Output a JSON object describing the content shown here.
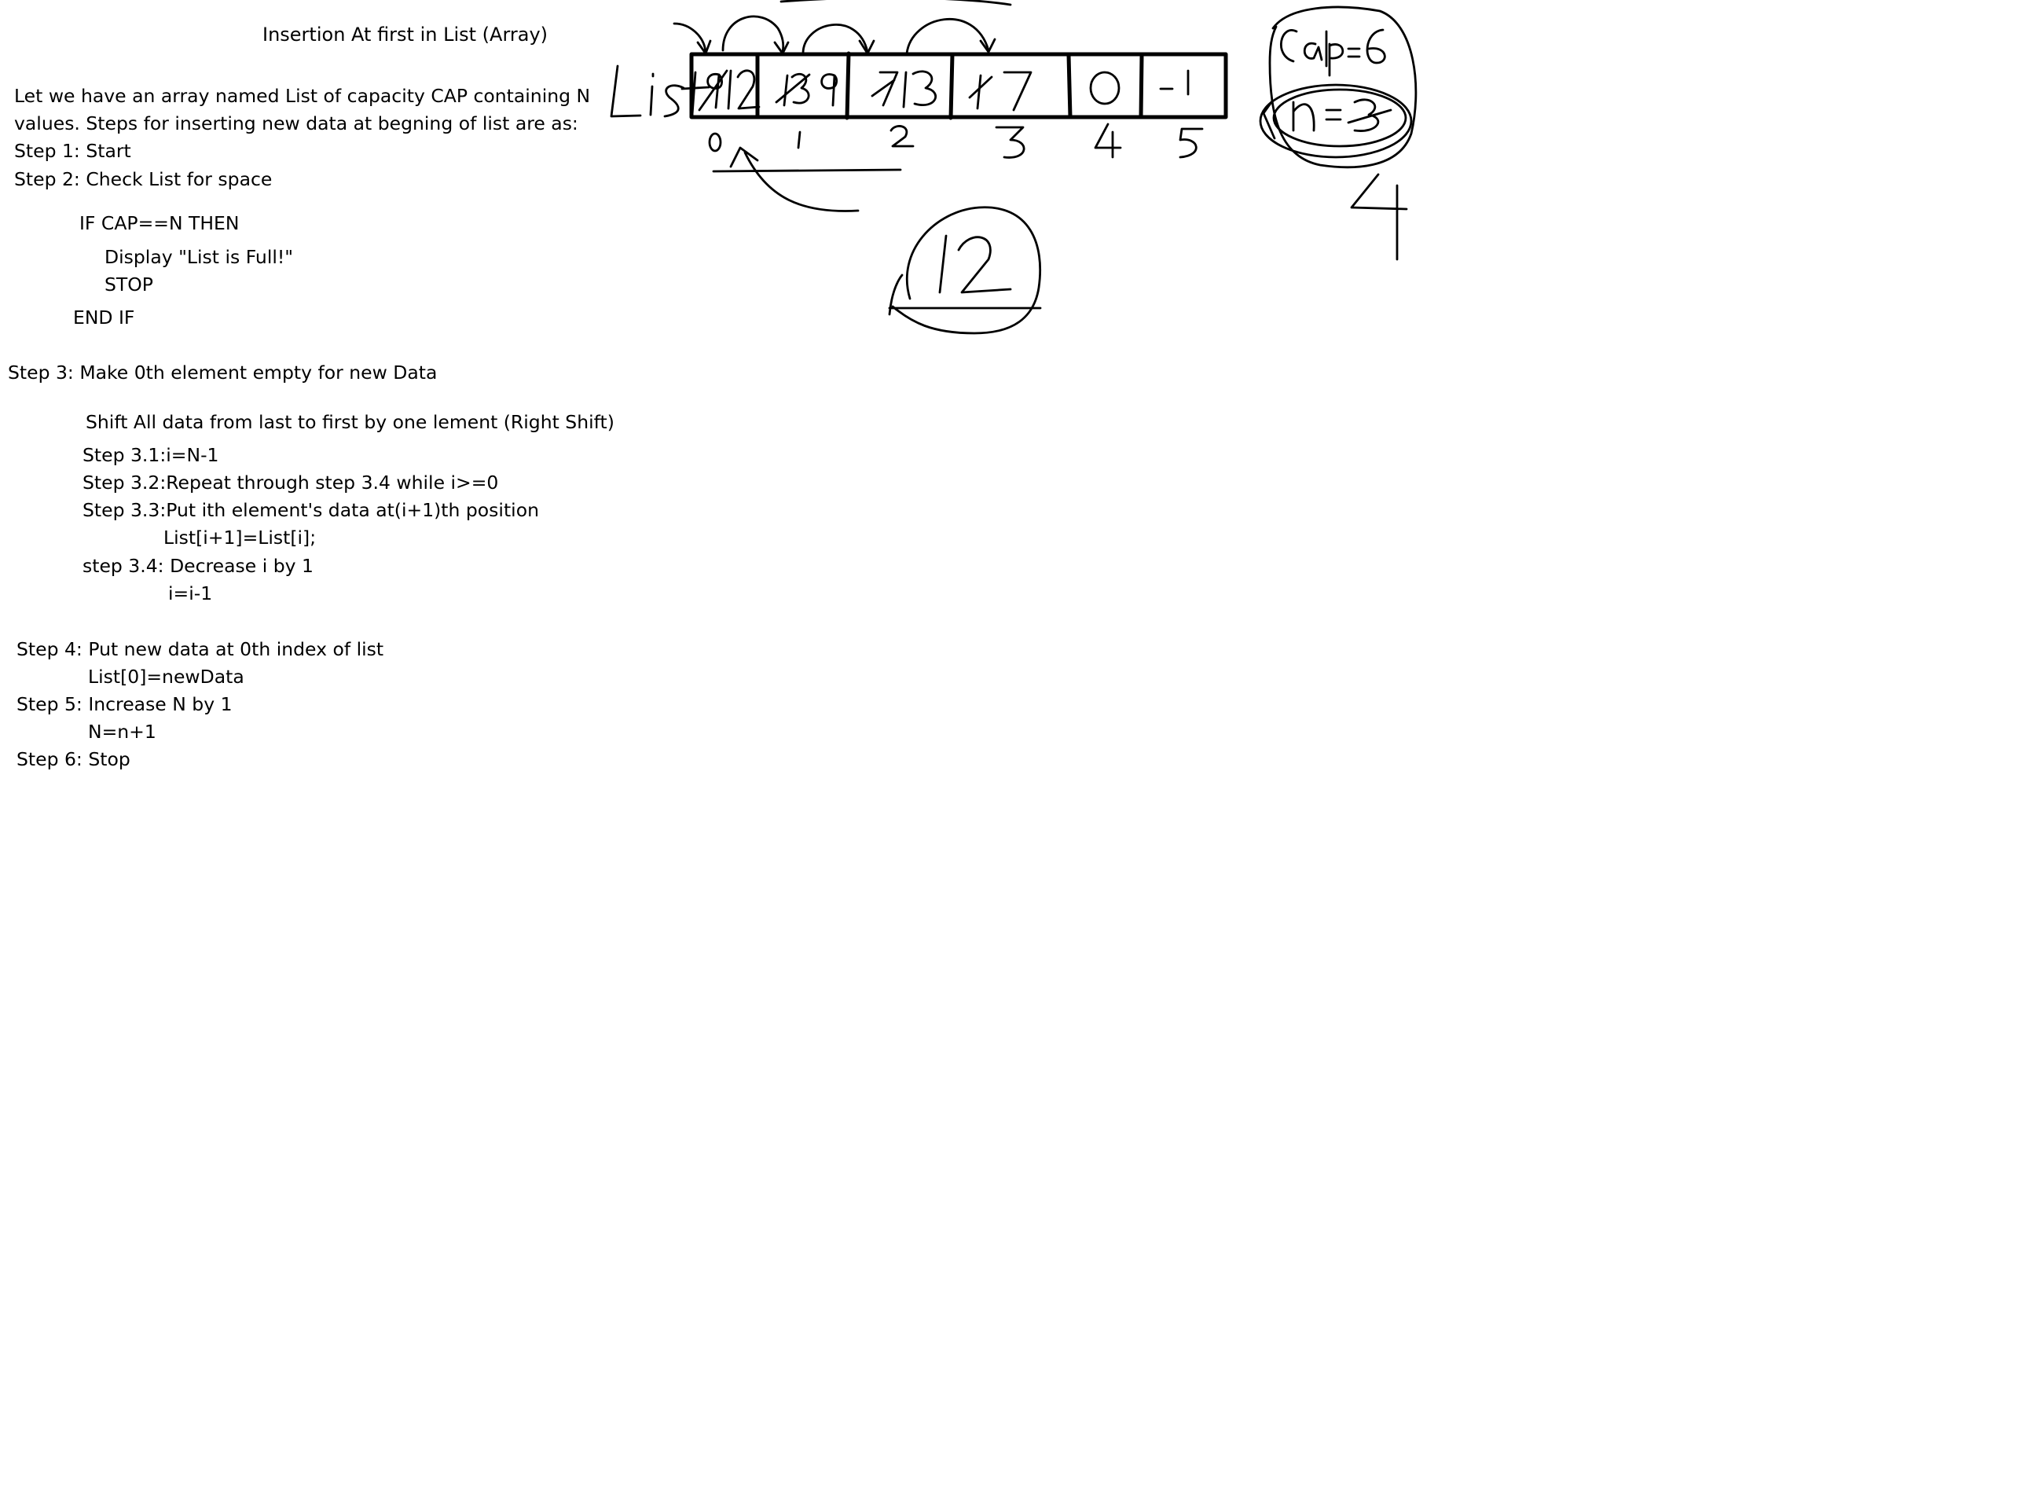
{
  "document": {
    "title": "Insertion At first in List (Array)",
    "intro_line1": "Let we have an array named List of capacity CAP containing N",
    "intro_line2": "values. Steps for inserting new data at begning of list are as:",
    "step1": "Step 1: Start",
    "step2": "Step 2: Check List for space",
    "if_line": "IF CAP==N  THEN",
    "display_line": "Display \"List is Full!\"",
    "stop_line": "STOP",
    "endif_line": "END IF",
    "step3": "Step 3: Make 0th element empty for new Data",
    "shift_line": "Shift All data from last to first by one lement (Right Shift)",
    "step3_1": "Step 3.1:i=N-1",
    "step3_2": "Step 3.2:Repeat through step 3.4 while i>=0",
    "step3_3": "Step 3.3:Put ith element's data at(i+1)th position",
    "step3_3_code": "List[i+1]=List[i];",
    "step3_4": "step 3.4: Decrease i by 1",
    "step3_4_code": "i=i-1",
    "step4": "Step 4: Put new data at 0th index of list",
    "step4_code": "List[0]=newData",
    "step5": "Step 5: Increase N by 1",
    "step5_code": "N=n+1",
    "step6": "Step 6: Stop"
  },
  "sketch": {
    "array_label": "List",
    "cells": [
      {
        "index": "0",
        "old_value": "9",
        "new_value": "12"
      },
      {
        "index": "1",
        "old_value": "13",
        "new_value": "9"
      },
      {
        "index": "2",
        "old_value": "7",
        "new_value": "13"
      },
      {
        "index": "3",
        "old_value": "1",
        "new_value": "7"
      },
      {
        "index": "4",
        "old_value": "",
        "new_value": "0"
      },
      {
        "index": "5",
        "old_value": "",
        "new_value": "-1"
      }
    ],
    "capacity_note": "Cap=6",
    "count_note": "n=3",
    "count_update": "4",
    "new_data": "12"
  }
}
